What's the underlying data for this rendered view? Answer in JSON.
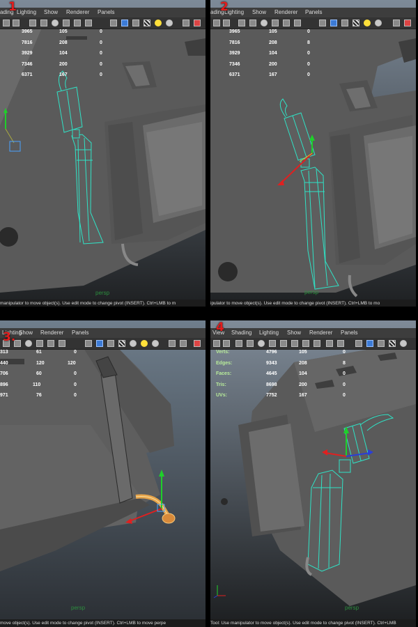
{
  "panels": [
    {
      "number": "1",
      "menu": [
        "ading",
        "Lighting",
        "Show",
        "Renderer",
        "Panels"
      ],
      "stats": [
        [
          "3965",
          "105",
          "0"
        ],
        [
          "7816",
          "208",
          "0"
        ],
        [
          "3929",
          "104",
          "0"
        ],
        [
          "7346",
          "200",
          "0"
        ],
        [
          "6371",
          "167",
          "0"
        ]
      ],
      "camera": "persp",
      "status": "manipulator to move object(s). Use edit mode to change pivot (INSERT).  Ctrl+LMB to m"
    },
    {
      "number": "2",
      "menu": [
        "ading",
        "Lighting",
        "Show",
        "Renderer",
        "Panels"
      ],
      "stats": [
        [
          "3965",
          "105",
          "0"
        ],
        [
          "7816",
          "208",
          "8"
        ],
        [
          "3929",
          "104",
          "0"
        ],
        [
          "7346",
          "200",
          "0"
        ],
        [
          "6371",
          "167",
          "0"
        ]
      ],
      "camera": "persp",
      "status": "ipulator to move object(s). Use edit mode to change pivot (INSERT).  Ctrl+LMB to mo"
    },
    {
      "number": "3.",
      "menu": [
        "Lighting",
        "Show",
        "Renderer",
        "Panels"
      ],
      "stats": [
        [
          "313",
          "61",
          "0"
        ],
        [
          "440",
          "120",
          "120"
        ],
        [
          "706",
          "60",
          "0"
        ],
        [
          "896",
          "110",
          "0"
        ],
        [
          "971",
          "76",
          "0"
        ]
      ],
      "camera": "persp",
      "status": "move object(s). Use edit mode to change pivot (INSERT).  Ctrl+LMB to move perpe"
    },
    {
      "number": "4",
      "menu": [
        "View",
        "Shading",
        "Lighting",
        "Show",
        "Renderer",
        "Panels"
      ],
      "stats": [
        [
          "Verts:",
          "4796",
          "105",
          "0"
        ],
        [
          "Edges:",
          "9343",
          "208",
          "8"
        ],
        [
          "Faces:",
          "4645",
          "104",
          "0"
        ],
        [
          "Tris:",
          "8698",
          "200",
          "0"
        ],
        [
          "UVs:",
          "7752",
          "167",
          "0"
        ]
      ],
      "camera": "persp",
      "status": "Tool: Use manipulator to move object(s). Use edit mode to change pivot (INSERT).  Ctrl+LMB"
    }
  ],
  "colors": {
    "selection_wire": "#2fe3c6",
    "manip_x": "#e02020",
    "manip_y": "#1fcf2a",
    "manip_z": "#2a3ed8",
    "label_number": "#e21c1c",
    "camera_label": "#2c8f3e"
  },
  "icons": [
    "select-icon",
    "lasso-icon",
    "grid-icon",
    "camera-icon",
    "wireframe-icon",
    "smooth-shade-icon",
    "texture-icon",
    "light-icon",
    "shadow-icon",
    "isolate-icon"
  ]
}
